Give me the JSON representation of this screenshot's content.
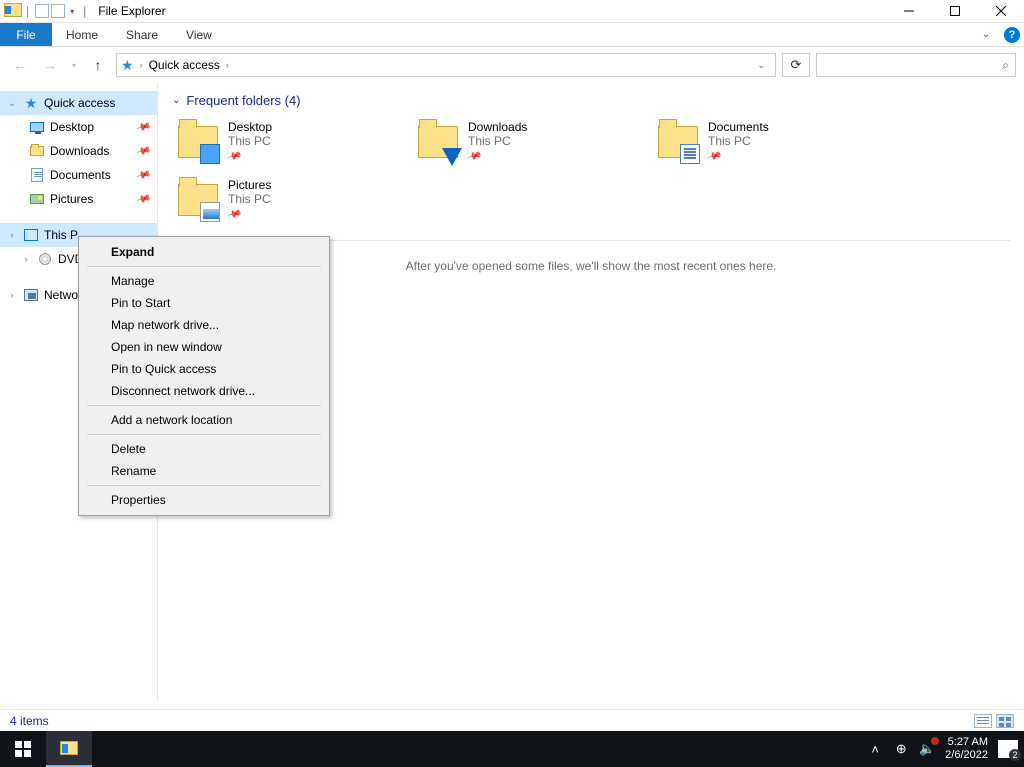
{
  "window": {
    "title": "File Explorer"
  },
  "ribbon": {
    "file": "File",
    "tabs": [
      "Home",
      "Share",
      "View"
    ]
  },
  "address": {
    "crumb": "Quick access"
  },
  "search": {
    "placeholder": ""
  },
  "sidebar": {
    "quick_access": "Quick access",
    "pinned": [
      {
        "label": "Desktop"
      },
      {
        "label": "Downloads"
      },
      {
        "label": "Documents"
      },
      {
        "label": "Pictures"
      }
    ],
    "this_pc": "This P",
    "dvd": "DVD D",
    "network": "Netwo"
  },
  "group": {
    "header": "Frequent folders (4)",
    "folders": [
      {
        "name": "Desktop",
        "sub": "This PC"
      },
      {
        "name": "Downloads",
        "sub": "This PC"
      },
      {
        "name": "Documents",
        "sub": "This PC"
      },
      {
        "name": "Pictures",
        "sub": "This PC"
      }
    ]
  },
  "recent_msg": "After you've opened some files, we'll show the most recent ones here.",
  "context_menu": {
    "items": [
      {
        "label": "Expand",
        "bold": true
      },
      {
        "sep": true
      },
      {
        "label": "Manage"
      },
      {
        "label": "Pin to Start"
      },
      {
        "label": "Map network drive..."
      },
      {
        "label": "Open in new window"
      },
      {
        "label": "Pin to Quick access"
      },
      {
        "label": "Disconnect network drive..."
      },
      {
        "sep": true
      },
      {
        "label": "Add a network location"
      },
      {
        "sep": true
      },
      {
        "label": "Delete"
      },
      {
        "label": "Rename"
      },
      {
        "sep": true
      },
      {
        "label": "Properties"
      }
    ]
  },
  "status": {
    "text": "4 items"
  },
  "tray": {
    "time": "5:27 AM",
    "date": "2/6/2022",
    "notif_count": "2"
  }
}
